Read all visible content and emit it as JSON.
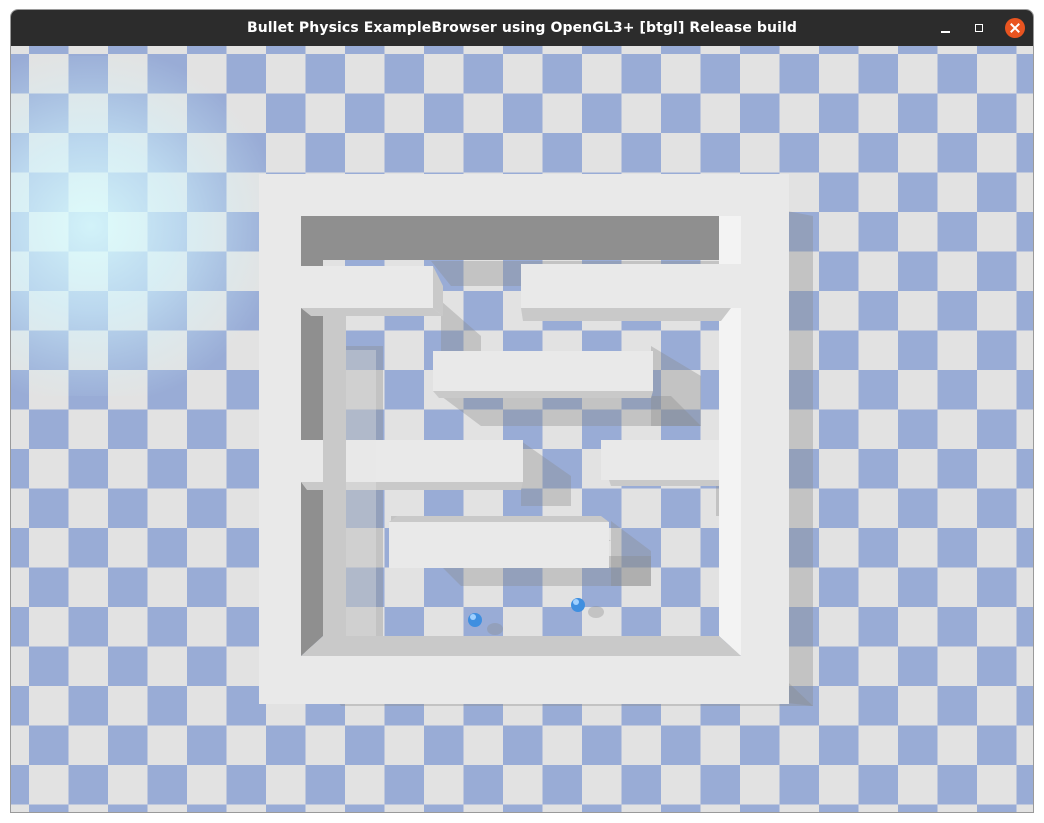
{
  "window": {
    "title": "Bullet Physics ExampleBrowser using OpenGL3+ [btgl] Release build"
  },
  "controls": {
    "minimize_icon": "minimize-icon",
    "maximize_icon": "maximize-icon",
    "close_icon": "close-icon"
  },
  "scene": {
    "floor_colors": [
      "#99acd6",
      "#e2e2e2"
    ],
    "wall_color": "#e9e9e9",
    "ball_color": "#3f8fe0"
  }
}
